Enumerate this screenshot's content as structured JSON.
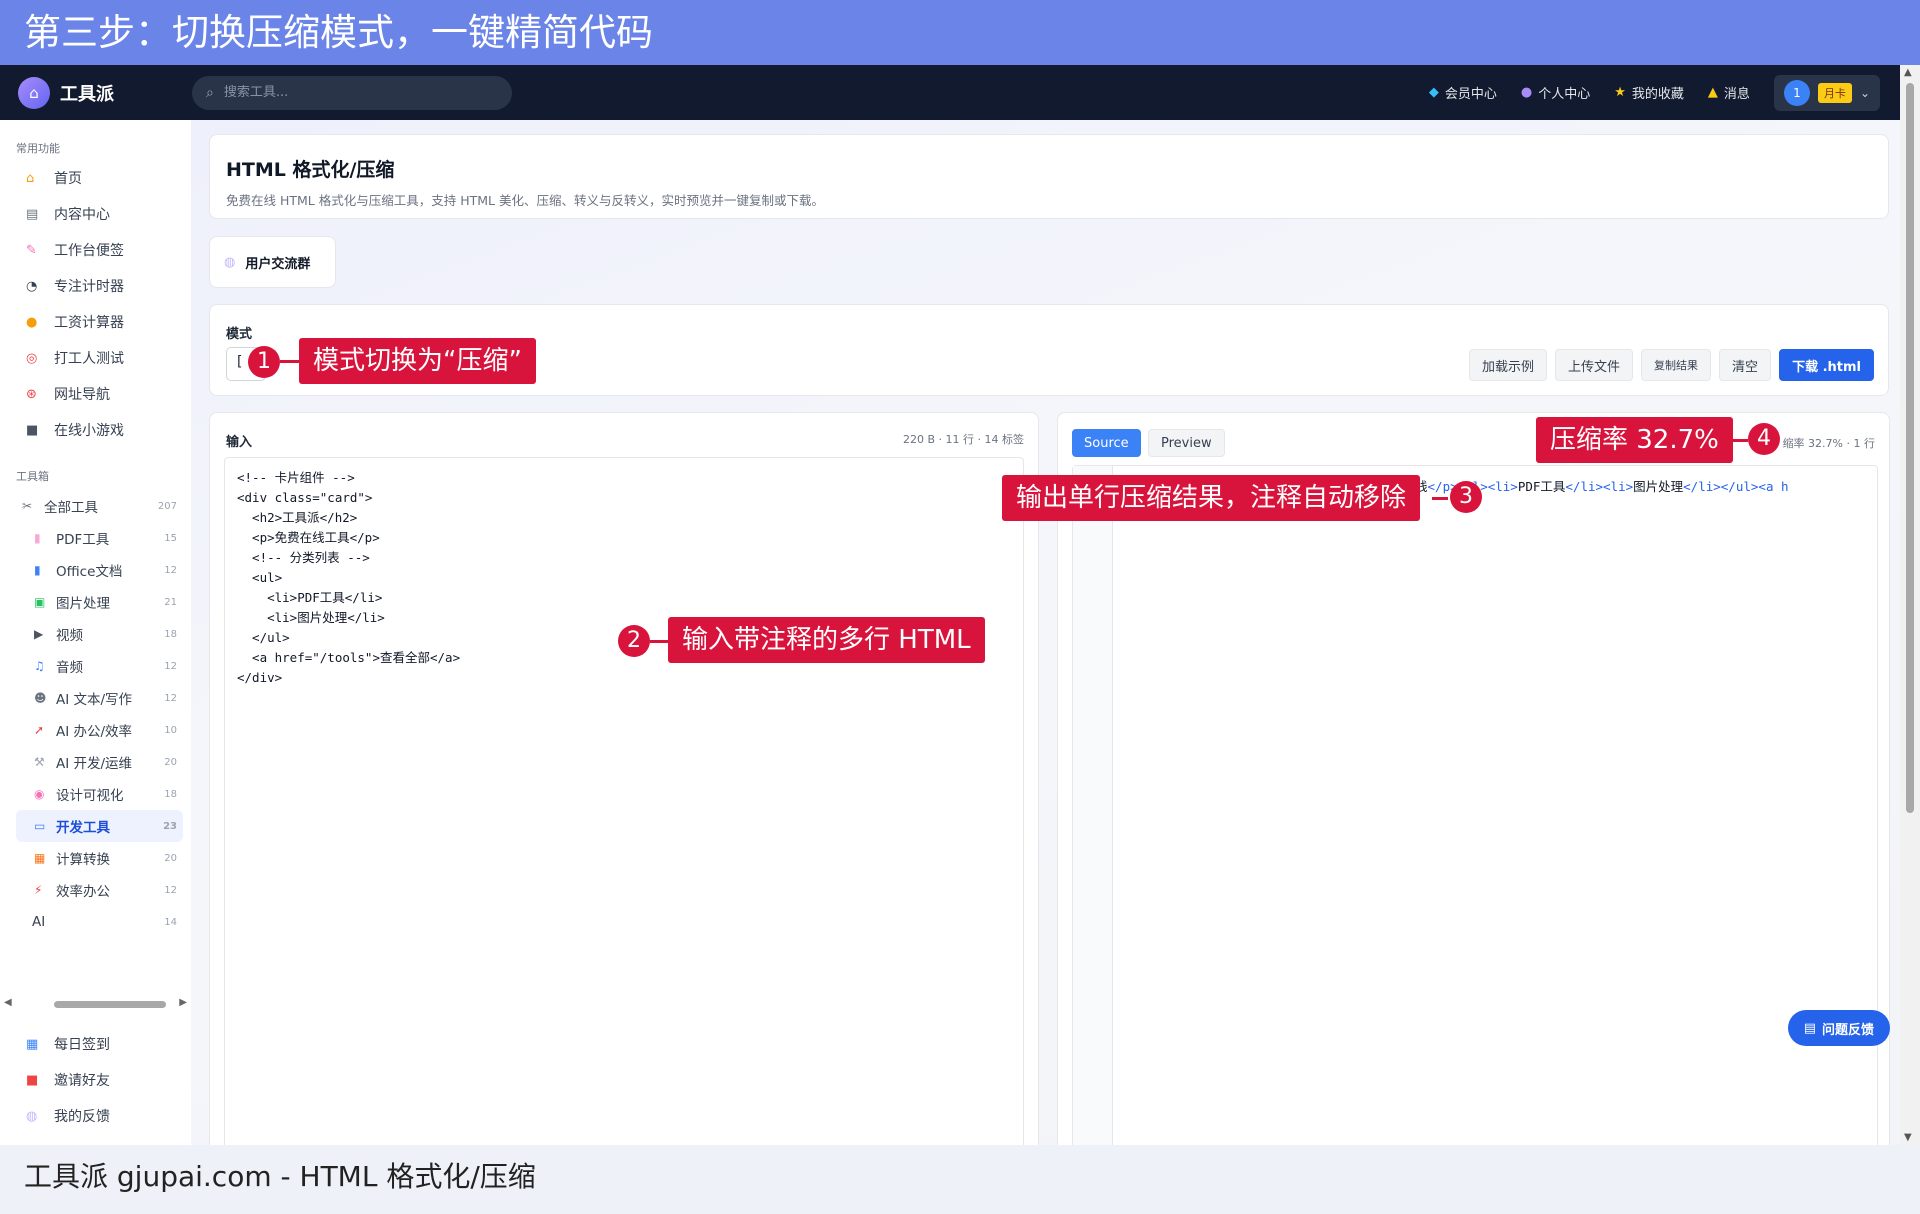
{
  "banner": {
    "title": "第三步：切换压缩模式，一键精简代码"
  },
  "topbar": {
    "app_name": "工具派",
    "search_placeholder": "搜索工具...",
    "nav": [
      {
        "icon": "diamond-icon",
        "label": "会员中心"
      },
      {
        "icon": "person-icon",
        "label": "个人中心"
      },
      {
        "icon": "star-icon",
        "label": "我的收藏"
      },
      {
        "icon": "bell-icon",
        "label": "消息"
      }
    ],
    "avatar_text": "1",
    "badge": "月卡"
  },
  "sidebar": {
    "section_common": "常用功能",
    "common": [
      {
        "icon": "home-icon",
        "label": "首页"
      },
      {
        "icon": "content-icon",
        "label": "内容中心"
      },
      {
        "icon": "note-icon",
        "label": "工作台便签"
      },
      {
        "icon": "timer-icon",
        "label": "专注计时器"
      },
      {
        "icon": "moneybag-icon",
        "label": "工资计算器"
      },
      {
        "icon": "target-icon",
        "label": "打工人测试"
      },
      {
        "icon": "compass-icon",
        "label": "网址导航"
      },
      {
        "icon": "gamepad-icon",
        "label": "在线小游戏"
      }
    ],
    "section_tools": "工具箱",
    "all_tools": {
      "label": "全部工具",
      "count": "207"
    },
    "tools": [
      {
        "label": "PDF工具",
        "count": "15"
      },
      {
        "label": "Office文档",
        "count": "12"
      },
      {
        "label": "图片处理",
        "count": "21"
      },
      {
        "label": "视频",
        "count": "18"
      },
      {
        "label": "音频",
        "count": "12"
      },
      {
        "label": "AI 文本/写作",
        "count": "12"
      },
      {
        "label": "AI 办公/效率",
        "count": "10"
      },
      {
        "label": "AI 开发/运维",
        "count": "20"
      },
      {
        "label": "设计可视化",
        "count": "18"
      },
      {
        "label": "开发工具",
        "count": "23"
      },
      {
        "label": "计算转换",
        "count": "20"
      },
      {
        "label": "效率办公",
        "count": "12"
      },
      {
        "label": "AI",
        "count": "14"
      }
    ],
    "bottom": [
      {
        "icon": "calendar-icon",
        "label": "每日签到"
      },
      {
        "icon": "gift-icon",
        "label": "邀请好友"
      },
      {
        "icon": "feedback-icon",
        "label": "我的反馈"
      }
    ]
  },
  "page": {
    "title": "HTML 格式化/压缩",
    "subtitle": "免费在线 HTML 格式化与压缩工具，支持 HTML 美化、压缩、转义与反转义，实时预览并一键复制或下载。",
    "group_label": "用户交流群",
    "mode_label": "模式",
    "mode_value": "[",
    "buttons": [
      "加载示例",
      "上传文件",
      "复制结果",
      "清空",
      "下载 .html"
    ]
  },
  "input": {
    "title": "输入",
    "meta": "220 B · 11 行 · 14 标签",
    "lines": [
      "<!-- 卡片组件 -->",
      "<div class=\"card\">",
      "  <h2>工具派</h2>",
      "  <p>免费在线工具</p>",
      "  <!-- 分类列表 -->",
      "  <ul>",
      "    <li>PDF工具</li>",
      "    <li>图片处理</li>",
      "  </ul>",
      "  <a href=\"/tools\">查看全部</a>",
      "</div>"
    ]
  },
  "output": {
    "tab_source": "Source",
    "tab_preview": "Preview",
    "meta": "缩率 32.7% · 1 行",
    "line_prefix": "线",
    "line_parts": [
      "</p><ul><li>",
      "PDF工具",
      "</li><li>",
      "图片处理",
      "</li></ul><a h"
    ]
  },
  "feedback_button": "问题反馈",
  "footer": "工具派 gjupai.com - HTML 格式化/压缩",
  "callouts": [
    {
      "n": "1",
      "text": "模式切换为“压缩”"
    },
    {
      "n": "2",
      "text": "输入带注释的多行 HTML"
    },
    {
      "n": "3",
      "text": "输出单行压缩结果，注释自动移除"
    },
    {
      "n": "4",
      "text": "压缩率 32.7%"
    }
  ],
  "colors": {
    "accent": "#2563eb",
    "callout": "#d9143c",
    "banner": "#6b84e8",
    "topbar": "#111a2e"
  }
}
